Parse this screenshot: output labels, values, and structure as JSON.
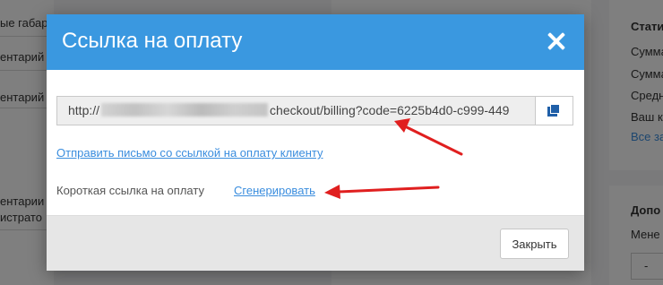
{
  "background": {
    "left_labels": [
      "ые габари",
      "ентарий",
      "ентарий",
      "ентарии",
      "истрато"
    ],
    "right_labels": [
      "Стати",
      "Сумма",
      "Сумма",
      "Средн",
      "Ваш к"
    ],
    "right_link": "Все за",
    "right_section": "Допо",
    "right_manager": "Мене",
    "right_select": "-"
  },
  "modal": {
    "title": "Ссылка на оплату",
    "link": {
      "prefix": "http://",
      "suffix": "checkout/billing?code=6225b4d0-c999-449"
    },
    "send_link_label": "Отправить письмо со ссылкой на оплату клиенту",
    "short_link_label": "Короткая ссылка на оплату",
    "generate_label": "Сгенерировать",
    "close_button": "Закрыть"
  },
  "colors": {
    "header": "#3a98e0",
    "link": "#3a8dde",
    "arrow": "#e01f1f"
  },
  "icons": [
    "close-icon",
    "copy-icon"
  ]
}
